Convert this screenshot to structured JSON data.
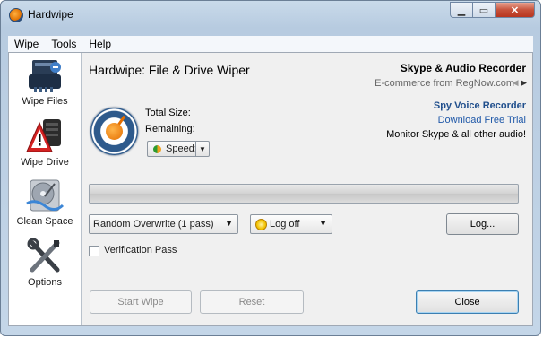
{
  "window": {
    "title": "Hardwipe"
  },
  "menu": [
    "Wipe",
    "Tools",
    "Help"
  ],
  "sidebar": [
    {
      "label": "Wipe Files",
      "icon": "file-shredder-icon"
    },
    {
      "label": "Wipe Drive",
      "icon": "drive-warning-icon"
    },
    {
      "label": "Clean Space",
      "icon": "hard-disk-icon"
    },
    {
      "label": "Options",
      "icon": "tools-icon"
    }
  ],
  "main": {
    "heading": "Hardwipe: File & Drive Wiper",
    "total_size_label": "Total Size:",
    "remaining_label": "Remaining:",
    "speed_label": "Speed:",
    "progress_percent": 0,
    "method_dropdown": "Random Overwrite (1 pass)",
    "action_dropdown": "Log off",
    "log_button": "Log...",
    "verification_label": "Verification Pass",
    "verification_checked": false,
    "start_button": "Start Wipe",
    "reset_button": "Reset",
    "close_button": "Close"
  },
  "ad": {
    "title": "Skype & Audio Recorder",
    "subtitle": "E-commerce from RegNow.com",
    "link1": "Spy Voice Recorder",
    "link2": "Download Free Trial",
    "text": "Monitor Skype & all other audio!"
  },
  "colors": {
    "accent": "#e46e00",
    "link": "#1f58a8",
    "dial_blue": "#2e5a8c"
  }
}
